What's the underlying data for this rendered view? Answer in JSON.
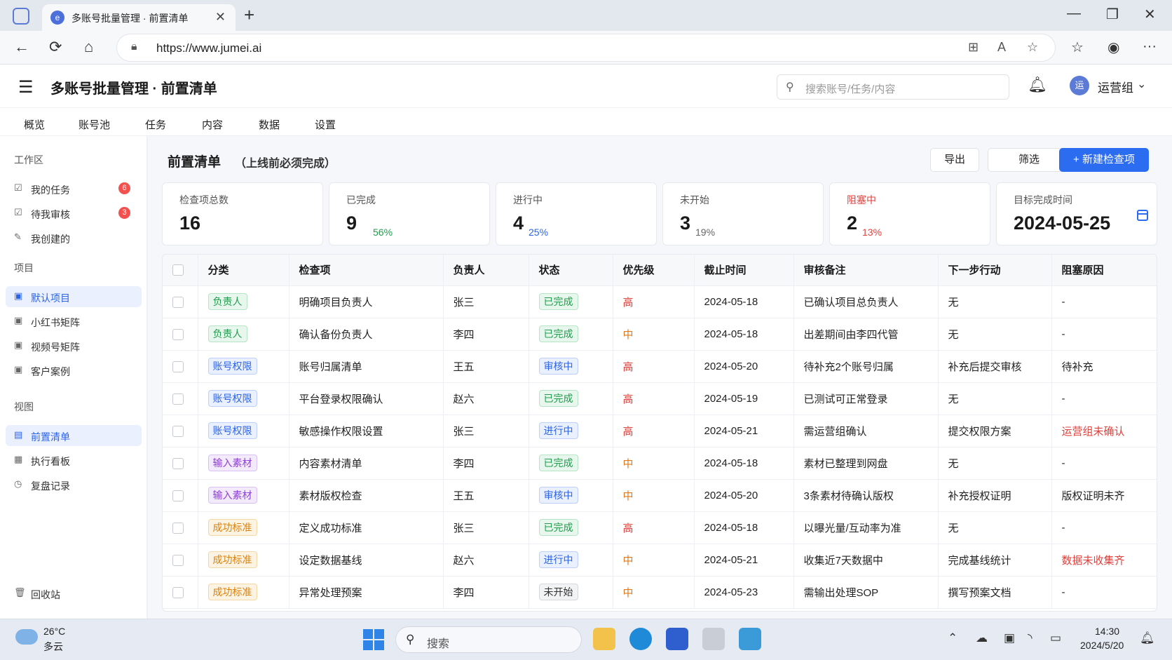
{
  "browser": {
    "tab_title": "多账号批量管理 · 前置清单",
    "url": "https://www.jumei.ai"
  },
  "app": {
    "title": "多账号批量管理 · 前置清单",
    "search_placeholder": "搜索账号/任务/内容",
    "avatar_text": "运",
    "team": "运营组"
  },
  "nav": [
    "概览",
    "账号池",
    "任务",
    "内容",
    "数据",
    "设置"
  ],
  "sidebar": {
    "workspace_title": "工作区",
    "workspace_items": [
      {
        "label": "我的任务",
        "badge": "6"
      },
      {
        "label": "待我审核",
        "badge": "3"
      },
      {
        "label": "我创建的",
        "badge": ""
      }
    ],
    "project_title": "项目",
    "project_items": [
      "默认项目",
      "小红书矩阵",
      "视频号矩阵",
      "客户案例"
    ],
    "view_title": "视图",
    "view_items": [
      "前置清单",
      "执行看板",
      "复盘记录"
    ],
    "trash": "回收站"
  },
  "page": {
    "title": "前置清单",
    "subtitle": "（上线前必须完成）",
    "export_label": "导出",
    "filter_label": "筛选",
    "new_label": "+ 新建检查项"
  },
  "stats": [
    {
      "label": "检查项总数",
      "value": "16",
      "pct": "",
      "color": "#555555"
    },
    {
      "label": "已完成",
      "value": "9",
      "pct": "56%",
      "color": "#1f9d4c"
    },
    {
      "label": "进行中",
      "value": "4",
      "pct": "25%",
      "color": "#2c64e8"
    },
    {
      "label": "未开始",
      "value": "3",
      "pct": "19%",
      "color": "#666666"
    },
    {
      "label": "阻塞中",
      "value": "2",
      "pct": "13%",
      "color": "#e0403c"
    },
    {
      "label": "目标完成时间",
      "value": "2024-05-25",
      "pct": "",
      "color": "#555555"
    }
  ],
  "table": {
    "headers": [
      "分类",
      "检查项",
      "负责人",
      "状态",
      "优先级",
      "截止时间",
      "审核备注",
      "下一步行动",
      "阻塞原因"
    ],
    "rows": [
      {
        "category": "负责人",
        "cat_type": "owner",
        "item": "明确项目负责人",
        "owner": "张三",
        "status": "已完成",
        "status_type": "done",
        "priority": "高",
        "due": "2024-05-18",
        "note": "已确认项目总负责人",
        "next": "无",
        "block": "-",
        "block_red": false
      },
      {
        "category": "负责人",
        "cat_type": "owner",
        "item": "确认备份负责人",
        "owner": "李四",
        "status": "已完成",
        "status_type": "done",
        "priority": "中",
        "due": "2024-05-18",
        "note": "出差期间由李四代管",
        "next": "无",
        "block": "-",
        "block_red": false
      },
      {
        "category": "账号权限",
        "cat_type": "perm",
        "item": "账号归属清单",
        "owner": "王五",
        "status": "审核中",
        "status_type": "rev",
        "priority": "高",
        "due": "2024-05-20",
        "note": "待补充2个账号归属",
        "next": "补充后提交审核",
        "block": "待补充",
        "block_red": false
      },
      {
        "category": "账号权限",
        "cat_type": "perm",
        "item": "平台登录权限确认",
        "owner": "赵六",
        "status": "已完成",
        "status_type": "done",
        "priority": "高",
        "due": "2024-05-19",
        "note": "已测试可正常登录",
        "next": "无",
        "block": "-",
        "block_red": false
      },
      {
        "category": "账号权限",
        "cat_type": "perm",
        "item": "敏感操作权限设置",
        "owner": "张三",
        "status": "进行中",
        "status_type": "prog",
        "priority": "高",
        "due": "2024-05-21",
        "note": "需运营组确认",
        "next": "提交权限方案",
        "block": "运营组未确认",
        "block_red": true
      },
      {
        "category": "输入素材",
        "cat_type": "mat",
        "item": "内容素材清单",
        "owner": "李四",
        "status": "已完成",
        "status_type": "done",
        "priority": "中",
        "due": "2024-05-18",
        "note": "素材已整理到网盘",
        "next": "无",
        "block": "-",
        "block_red": false
      },
      {
        "category": "输入素材",
        "cat_type": "mat",
        "item": "素材版权检查",
        "owner": "王五",
        "status": "审核中",
        "status_type": "rev",
        "priority": "中",
        "due": "2024-05-20",
        "note": "3条素材待确认版权",
        "next": "补充授权证明",
        "block": "版权证明未齐",
        "block_red": false
      },
      {
        "category": "成功标准",
        "cat_type": "std",
        "item": "定义成功标准",
        "owner": "张三",
        "status": "已完成",
        "status_type": "done",
        "priority": "高",
        "due": "2024-05-18",
        "note": "以曝光量/互动率为准",
        "next": "无",
        "block": "-",
        "block_red": false
      },
      {
        "category": "成功标准",
        "cat_type": "std",
        "item": "设定数据基线",
        "owner": "赵六",
        "status": "进行中",
        "status_type": "prog",
        "priority": "中",
        "due": "2024-05-21",
        "note": "收集近7天数据中",
        "next": "完成基线统计",
        "block": "数据未收集齐",
        "block_red": true
      },
      {
        "category": "成功标准",
        "cat_type": "std",
        "item": "异常处理预案",
        "owner": "李四",
        "status": "未开始",
        "status_type": "none",
        "priority": "中",
        "due": "2024-05-23",
        "note": "需输出处理SOP",
        "next": "撰写预案文档",
        "block": "-",
        "block_red": false
      }
    ]
  },
  "taskbar": {
    "temp": "26°C",
    "weather": "多云",
    "search_placeholder": "搜索",
    "time": "14:30",
    "date": "2024/5/20"
  }
}
